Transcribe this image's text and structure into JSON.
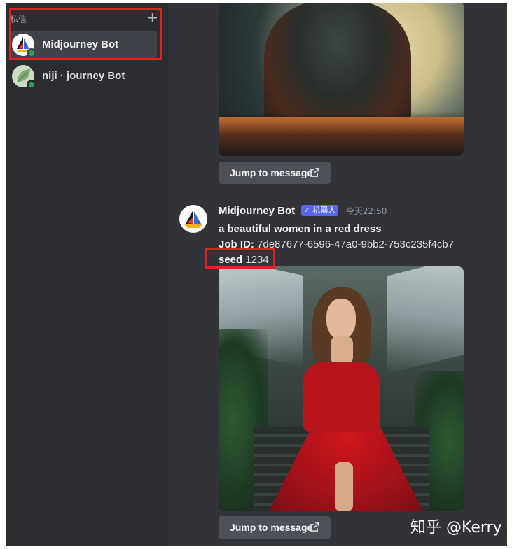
{
  "sidebar": {
    "section_label": "私信",
    "add_label": "+",
    "dms": [
      {
        "name": "Midjourney Bot",
        "active": true
      },
      {
        "name": "niji · journey Bot",
        "active": false
      }
    ]
  },
  "chat": {
    "jump_label": "Jump to message",
    "message": {
      "author": "Midjourney Bot",
      "bot_tag": "✓ 机器人",
      "time": "今天22:50",
      "prompt": "a beautiful women in a red dress",
      "job_id_label": "Job ID:",
      "job_id_value": "7de87677-6596-47a0-9bb2-753c235f4cb7",
      "seed_label": "seed",
      "seed_value": "1234"
    }
  },
  "watermark": "知乎 @Kerry",
  "colors": {
    "highlight": "#e0211d",
    "online": "#23a55a",
    "bot_tag": "#5865f2"
  }
}
